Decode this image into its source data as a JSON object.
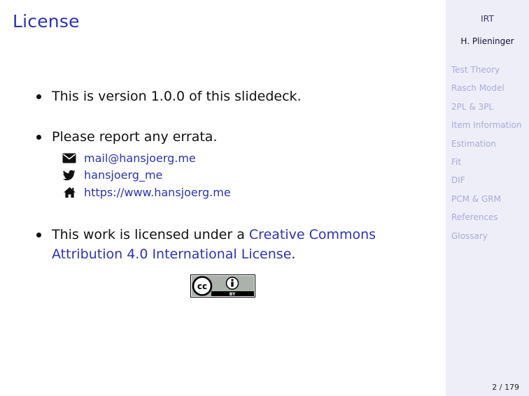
{
  "slide": {
    "title": "License",
    "bullets": {
      "version": "This is version 1.0.0 of this slidedeck.",
      "errata": "Please report any errata.",
      "license_prefix": "This work is licensed under a ",
      "license_link_line1": "Creative Commons",
      "license_link_line2": "Attribution 4.0 International License",
      "license_suffix": "."
    },
    "contacts": [
      {
        "icon": "envelope-icon",
        "text": "mail@hansjoerg.me"
      },
      {
        "icon": "twitter-icon",
        "text": "hansjoerg_me"
      },
      {
        "icon": "home-icon",
        "text": "https://www.hansjoerg.me"
      }
    ],
    "badge": {
      "cc": "cc",
      "by": "BY"
    }
  },
  "sidebar": {
    "title": "IRT",
    "author": "H. Plieninger",
    "nav": [
      "Test Theory",
      "Rasch Model",
      "2PL & 3PL",
      "Item Information",
      "Estimation",
      "Fit",
      "DIF",
      "PCM & GRM",
      "References",
      "Glossary"
    ]
  },
  "footer": {
    "page": "2 / 179"
  },
  "colors": {
    "accent": "#2c33b3",
    "sidebar_bg": "#eeeef9",
    "nav_text": "#a9abda"
  }
}
